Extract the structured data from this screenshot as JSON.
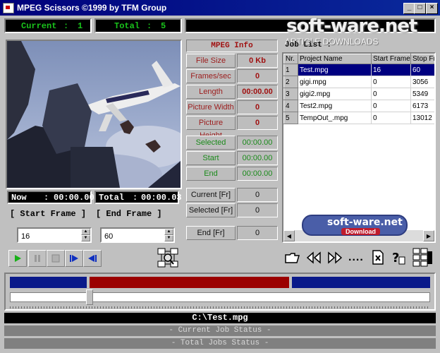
{
  "window": {
    "title": "MPEG Scissors ©1999 by TFM Group"
  },
  "counters": {
    "current_label": "Current",
    "current_value": "1",
    "total_label": "Total",
    "total_value": "5"
  },
  "watermark": {
    "brand": "soft-ware.net",
    "tagline": "ARTICLE DOWNLOADS",
    "badge": "soft-ware.net",
    "badge_sub": "Download"
  },
  "time": {
    "now_label": "Now",
    "now_value": "00:00.00",
    "total_label": "Total",
    "total_value": "00:00.03"
  },
  "frames": {
    "start_button": "[ Start Frame ]",
    "end_button": "[ End Frame ]",
    "start_value": "16",
    "end_value": "60"
  },
  "info": {
    "title": "MPEG Info",
    "rows": [
      {
        "label": "File Size",
        "value": "0 Kb"
      },
      {
        "label": "Frames/sec",
        "value": "0"
      },
      {
        "label": "Length",
        "value": "00:00.00"
      },
      {
        "label": "Picture Width",
        "value": "0"
      },
      {
        "label": "Picture Height",
        "value": "0"
      }
    ],
    "time_rows": [
      {
        "label": "Selected",
        "value": "00:00.00"
      },
      {
        "label": "Start",
        "value": "00:00.00"
      },
      {
        "label": "End",
        "value": "00:00.00"
      }
    ],
    "frame_rows": [
      {
        "label": "Current [Fr]",
        "value": "0"
      },
      {
        "label": "Selected [Fr]",
        "value": "0"
      }
    ],
    "end_row": {
      "label": "End [Fr]",
      "value": "0"
    }
  },
  "job_list": {
    "label": "Job List :",
    "columns": [
      "Nr.",
      "Project Name",
      "Start Frame",
      "Stop Fr"
    ],
    "rows": [
      {
        "nr": "1",
        "name": "Test.mpg",
        "start": "16",
        "stop": "60"
      },
      {
        "nr": "2",
        "name": "gigi.mpg",
        "start": "0",
        "stop": "3056"
      },
      {
        "nr": "3",
        "name": "gigi2.mpg",
        "start": "0",
        "stop": "5349"
      },
      {
        "nr": "4",
        "name": "Test2.mpg",
        "start": "0",
        "stop": "6173"
      },
      {
        "nr": "5",
        "name": "TempOut_.mpg",
        "start": "0",
        "stop": "13012"
      }
    ]
  },
  "toolbar": {
    "more_label": "...."
  },
  "timeline": {
    "position": 0.19,
    "selection_start": 0.19,
    "selection_end": 0.665
  },
  "status": {
    "file": "C:\\Test.mpg",
    "job_status": "- Current Job Status -",
    "total_status": "- Total Jobs Status -"
  },
  "colors": {
    "title_bar": "#00007b",
    "lcd_green": "#19c31b",
    "info_red": "#a01010",
    "selection_red": "#9b0000",
    "track_blue": "#0a1a8a"
  }
}
